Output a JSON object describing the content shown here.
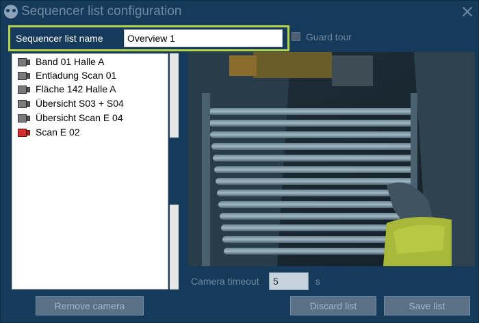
{
  "window": {
    "title": "Sequencer list configuration"
  },
  "name_field": {
    "label": "Sequencer list name",
    "value": "Overview 1"
  },
  "guard_tour": {
    "label": "Guard tour",
    "checked": false
  },
  "cameras": [
    {
      "label": "Band 01 Halle A",
      "icon": "camera-icon",
      "status": "normal"
    },
    {
      "label": "Entladung Scan 01",
      "icon": "camera-icon",
      "status": "normal"
    },
    {
      "label": "Fläche 142 Halle A",
      "icon": "camera-icon",
      "status": "normal"
    },
    {
      "label": "Übersicht S03 + S04",
      "icon": "camera-icon",
      "status": "normal"
    },
    {
      "label": "Übersicht Scan E 04",
      "icon": "camera-icon",
      "status": "normal"
    },
    {
      "label": "Scan E 02",
      "icon": "camera-icon",
      "status": "alert"
    }
  ],
  "timeout": {
    "label": "Camera timeout",
    "value": "5",
    "unit": "s"
  },
  "buttons": {
    "remove": "Remove camera",
    "discard": "Discard list",
    "save": "Save list"
  },
  "colors": {
    "background": "#163a59",
    "highlight_border": "#b8d44a",
    "alert_camera": "#d03030"
  }
}
